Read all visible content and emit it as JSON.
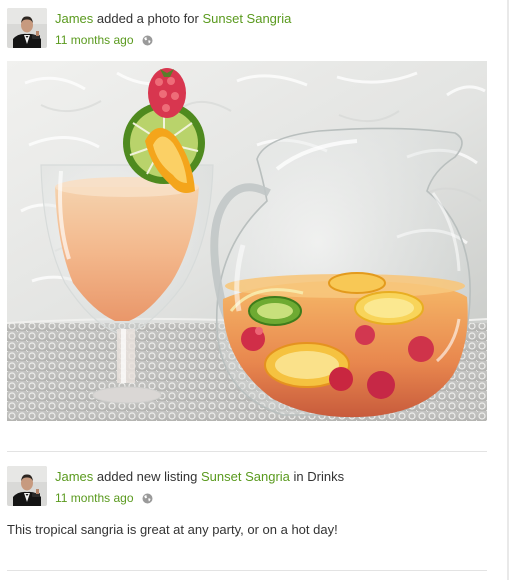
{
  "feed": {
    "items": [
      {
        "user": "James",
        "action": "added a photo for",
        "target": "Sunset Sangria",
        "time": "11 months ago",
        "avatar_icon": "user-avatar",
        "privacy_icon": "globe-icon"
      },
      {
        "user": "James",
        "action": "added new listing",
        "target": "Sunset Sangria",
        "suffix": "in Drinks",
        "time": "11 months ago",
        "avatar_icon": "user-avatar",
        "privacy_icon": "globe-icon",
        "body": "This tropical sangria is great at any party, or on a hot day!"
      }
    ]
  },
  "colors": {
    "link": "#5a9a1e",
    "text": "#333333",
    "divider": "#e3e3e3"
  }
}
